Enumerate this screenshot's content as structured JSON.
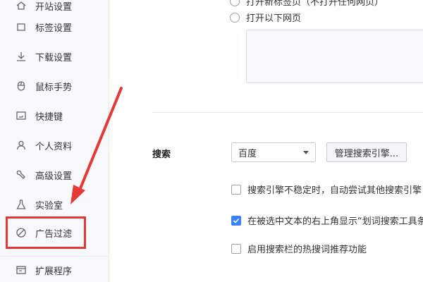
{
  "sidebar": {
    "items": [
      {
        "label": "开站设置",
        "icon": "home-icon"
      },
      {
        "label": "标签设置",
        "icon": "tab-icon"
      },
      {
        "label": "下载设置",
        "icon": "download-icon"
      },
      {
        "label": "鼠标手势",
        "icon": "mouse-icon"
      },
      {
        "label": "快捷键",
        "icon": "keyboard-icon"
      },
      {
        "label": "个人资料",
        "icon": "user-icon"
      },
      {
        "label": "高级设置",
        "icon": "wrench-icon"
      },
      {
        "label": "实验室",
        "icon": "flask-icon"
      },
      {
        "label": "广告过滤",
        "icon": "block-icon"
      },
      {
        "label": "扩展程序",
        "icon": "extension-icon"
      }
    ],
    "highlight_color": "#e53935"
  },
  "startup": {
    "option_top_label": "打开新标签页（不打开任何网页）",
    "option_open_pages": "打开以下网页"
  },
  "search": {
    "section_label": "搜索",
    "engine_selected": "百度",
    "manage_button": "管理搜索引擎...",
    "options": [
      {
        "label": "搜索引擎不稳定时，自动尝试其他搜索引擎",
        "checked": false
      },
      {
        "label": "在被选中文本的右上角显示“划词搜索工具条”",
        "checked": true
      },
      {
        "label": "启用搜索栏的热搜词推荐功能",
        "checked": false
      }
    ]
  },
  "colors": {
    "accent": "#3b82f6",
    "annotation": "#e53935"
  }
}
